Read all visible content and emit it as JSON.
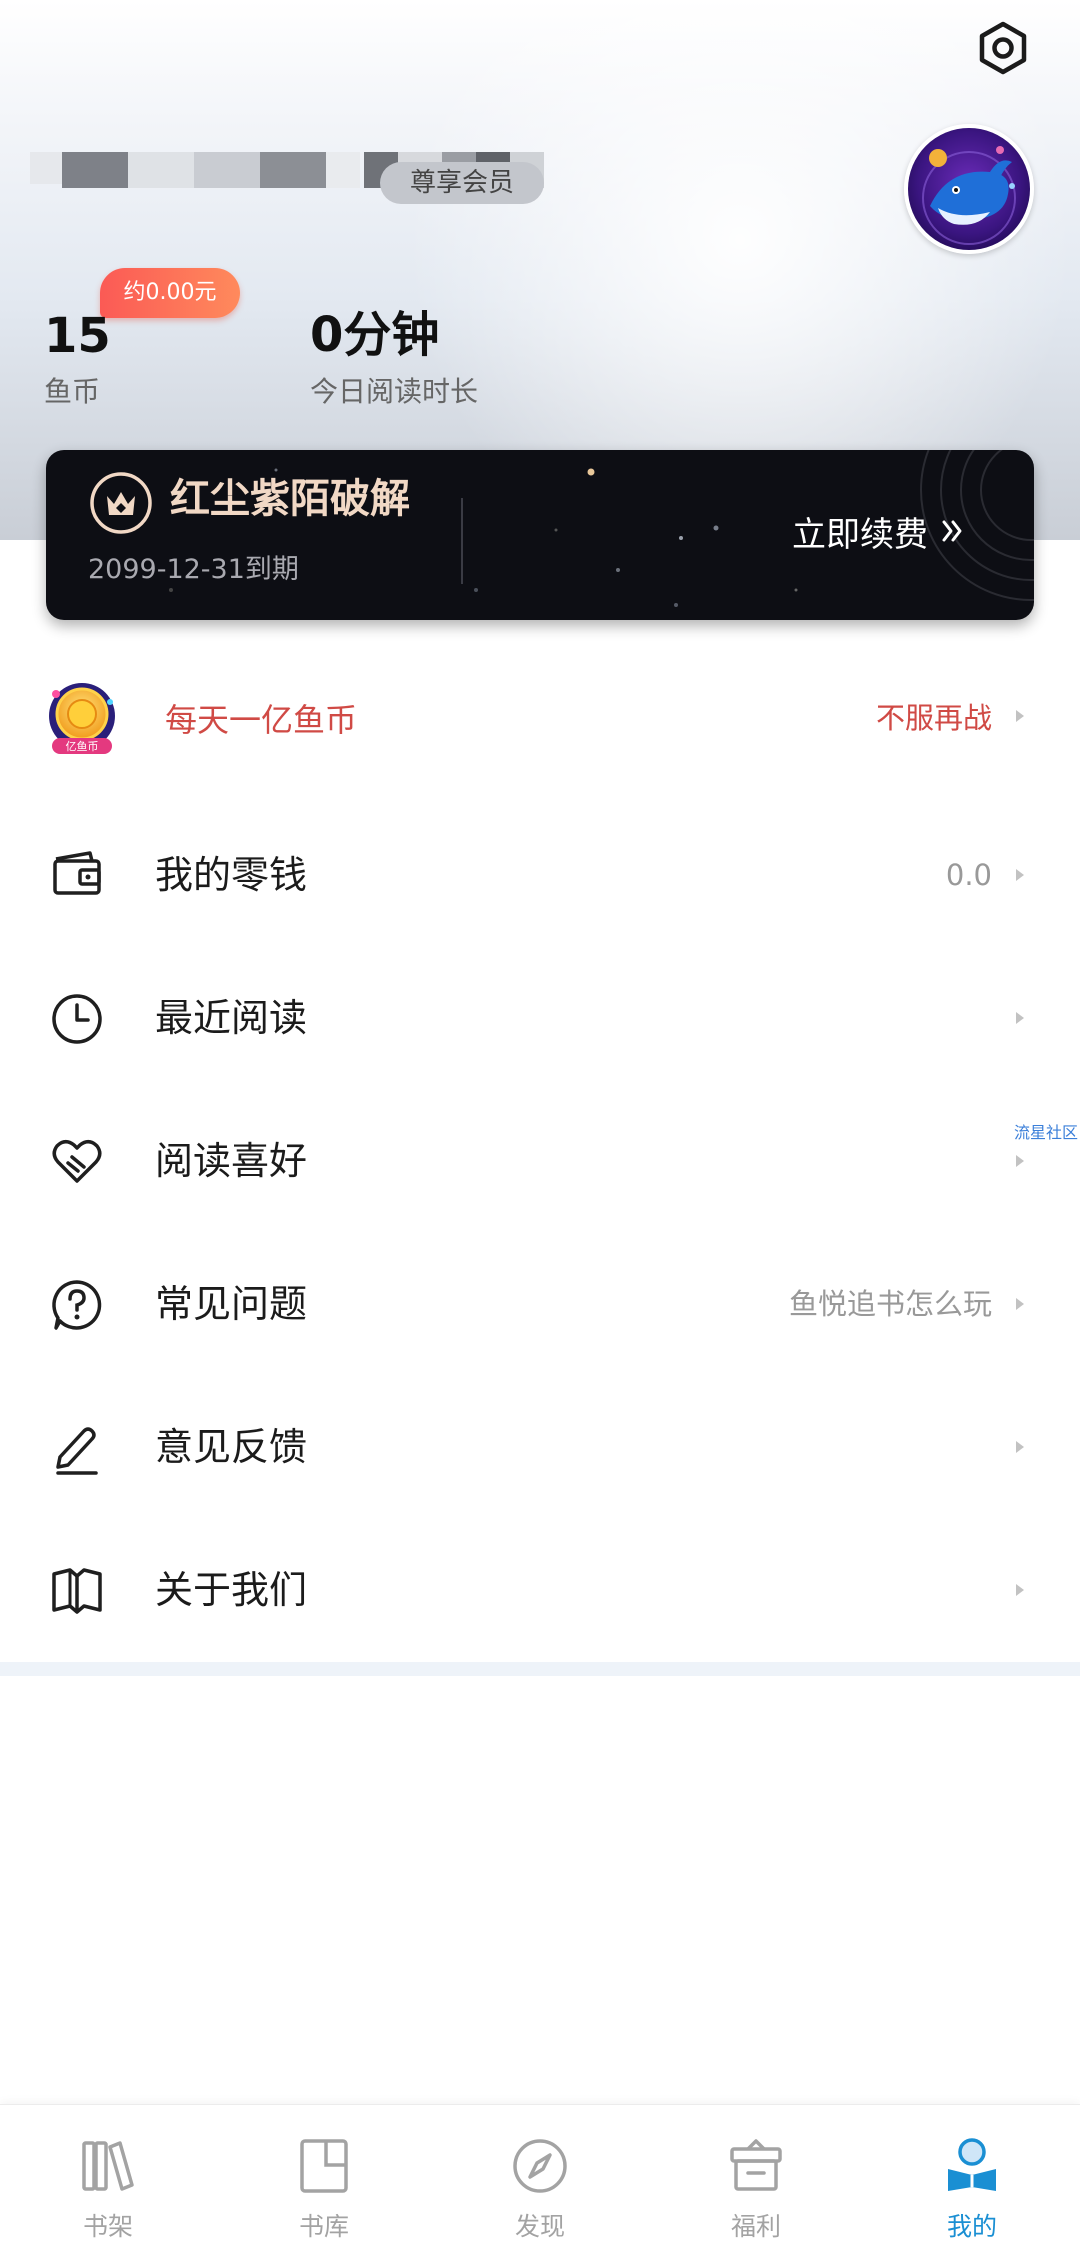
{
  "header": {
    "settings_icon": "settings-hexagon-icon",
    "avatar_icon": "whale-avatar",
    "member_tag": "尊享会员"
  },
  "stats": {
    "coin_badge": "约0.00元",
    "coins_value": "15",
    "coins_label": "鱼币",
    "reading_value": "0分钟",
    "reading_label": "今日阅读时长"
  },
  "vip_card": {
    "title": "红尘紫陌破解",
    "expiry": "2099-12-31到期",
    "renew_label": "立即续费",
    "colors": {
      "title": "#f1d8c5",
      "background": "#0d0e14"
    }
  },
  "promo": {
    "label": "每天一亿鱼币",
    "right_text": "不服再战",
    "icon": "gold-coin-badge-icon",
    "icon_caption": "亿鱼币"
  },
  "menu": {
    "items": [
      {
        "label": "我的零钱",
        "right": "0.0",
        "icon": "wallet-icon"
      },
      {
        "label": "最近阅读",
        "right": "",
        "icon": "clock-icon"
      },
      {
        "label": "阅读喜好",
        "right": "",
        "icon": "heart-icon"
      },
      {
        "label": "常见问题",
        "right": "鱼悦追书怎么玩",
        "icon": "question-icon"
      },
      {
        "label": "意见反馈",
        "right": "",
        "icon": "edit-icon"
      },
      {
        "label": "关于我们",
        "right": "",
        "icon": "open-book-icon"
      }
    ]
  },
  "side_link": "流星社区",
  "bottom_nav": {
    "tabs": [
      {
        "label": "书架",
        "icon": "bookshelf-icon",
        "active": false
      },
      {
        "label": "书库",
        "icon": "library-icon",
        "active": false
      },
      {
        "label": "发现",
        "icon": "compass-icon",
        "active": false
      },
      {
        "label": "福利",
        "icon": "gift-box-icon",
        "active": false
      },
      {
        "label": "我的",
        "icon": "reader-profile-icon",
        "active": true
      }
    ],
    "colors": {
      "active": "#1a8fd3",
      "inactive": "#a3a3a3"
    }
  }
}
